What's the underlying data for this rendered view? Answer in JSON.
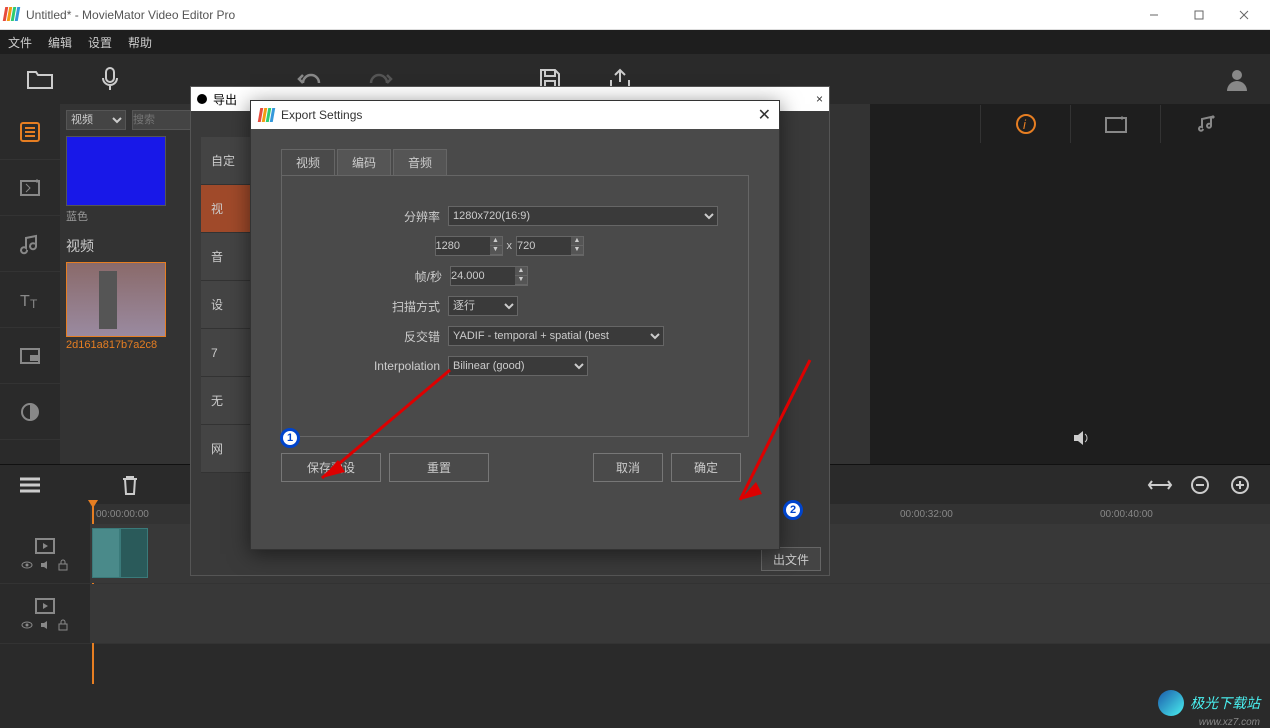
{
  "window": {
    "title": "Untitled* - MovieMator Video Editor Pro"
  },
  "menu": {
    "file": "文件",
    "edit": "编辑",
    "settings": "设置",
    "help": "帮助"
  },
  "media": {
    "type_select": "视频",
    "search_placeholder": "搜索",
    "blue_label": "蓝色",
    "video_heading": "视频",
    "clip_name": "2d161a817b7a2c8"
  },
  "export_parent": {
    "title": "导出",
    "presets": {
      "custom": "自定",
      "video": "视",
      "audio": "音",
      "device": "设",
      "seq": "7",
      "none": "无",
      "net": "网"
    },
    "output_file": "出文件"
  },
  "dlg": {
    "title": "Export Settings",
    "tabs": {
      "video": "视频",
      "encode": "编码",
      "audio": "音频"
    },
    "labels": {
      "resolution": "分辨率",
      "fps": "帧/秒",
      "scan": "扫描方式",
      "deinterlace": "反交错",
      "interpolation": "Interpolation"
    },
    "values": {
      "resolution": "1280x720(16:9)",
      "width": "1280",
      "height": "720",
      "fps": "24.000",
      "scan": "逐行",
      "deinterlace": "YADIF - temporal + spatial (best",
      "interpolation": "Bilinear (good)"
    },
    "btns": {
      "save_preset": "保存预设",
      "reset": "重置",
      "cancel": "取消",
      "ok": "确定"
    }
  },
  "timeline": {
    "t0": "00:00:00:00",
    "t1": "00:00:32:00",
    "t2": "00:00:40:00"
  },
  "watermark": {
    "text": "极光下载站",
    "url": "www.xz7.com"
  },
  "anno": {
    "one": "1",
    "two": "2"
  }
}
